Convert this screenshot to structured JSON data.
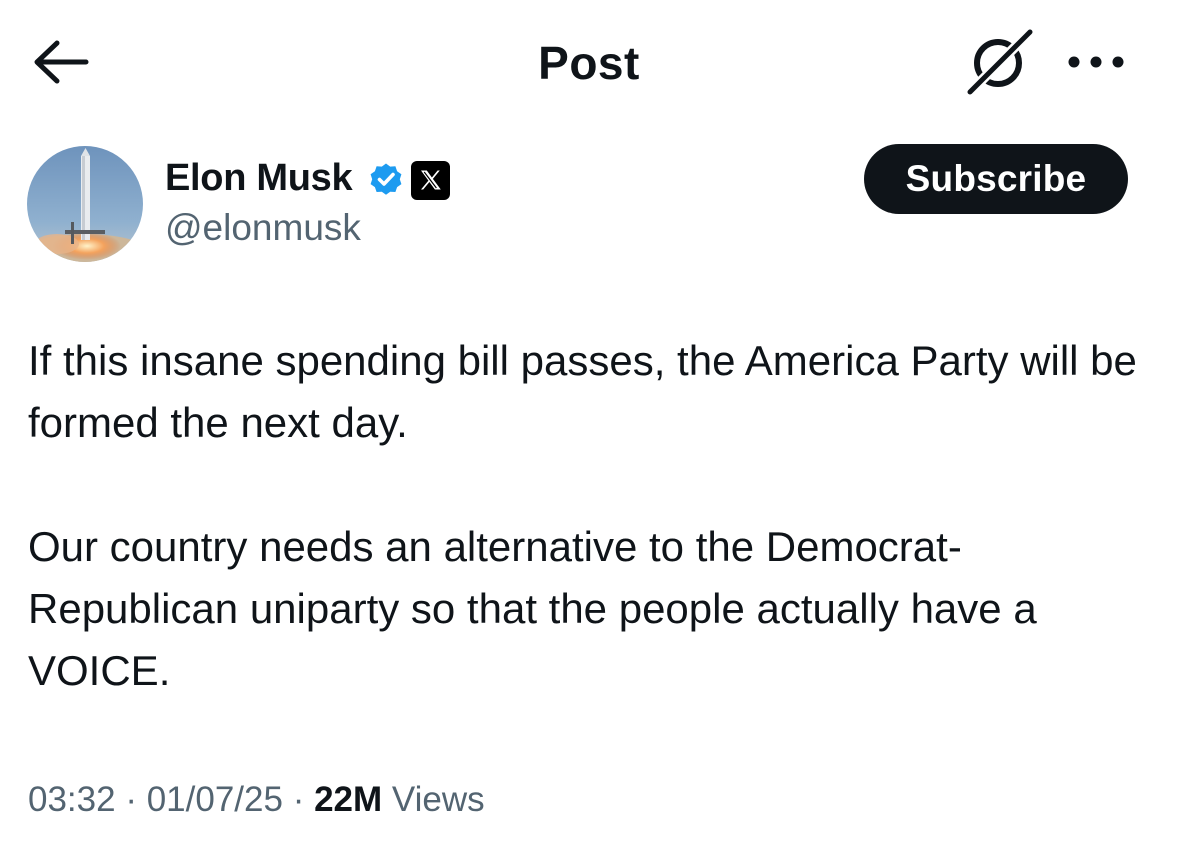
{
  "header": {
    "title": "Post",
    "back_icon": "arrow-left-icon",
    "grok_icon": "grok-icon",
    "more_icon": "more-dots-icon"
  },
  "author": {
    "name": "Elon Musk",
    "handle": "@elonmusk",
    "avatar_icon": "rocket-avatar",
    "verified_icon": "verified-badge-icon",
    "affiliate_icon": "x-logo-icon",
    "verified_color": "#1d9bf0"
  },
  "subscribe": {
    "label": "Subscribe"
  },
  "tweet": {
    "paragraphs": [
      "If this insane spending bill passes, the America Party will be formed the next day.",
      "Our country needs an alternative to the Democrat-Republican uniparty so that the people actually have a VOICE."
    ]
  },
  "meta": {
    "time": "03:32",
    "separator": "·",
    "date": "01/07/25",
    "views_count": "22M",
    "views_label": "Views"
  },
  "colors": {
    "text": "#0f1419",
    "secondary": "#536471",
    "accent": "#1d9bf0",
    "button_bg": "#0f1419"
  }
}
